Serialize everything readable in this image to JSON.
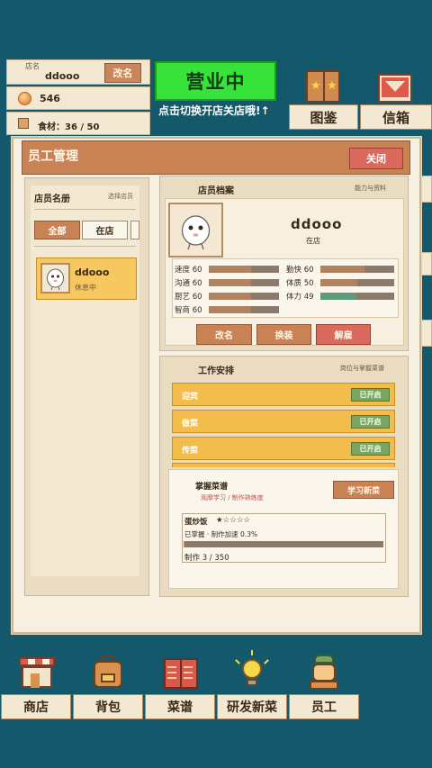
{
  "hud": {
    "name_label": "店名",
    "store_name": "ddooo",
    "rename_btn": "改名",
    "coins": "546",
    "food": "食材：36 / 50",
    "open_btn": "营业中",
    "open_hint": "点击切换开店关店哦!↑",
    "album_label": "图鉴",
    "mail_label": "信箱"
  },
  "modal": {
    "title": "员工管理",
    "close_btn": "关闭",
    "roster": {
      "title": "店员名册",
      "subtitle": "选择店员",
      "tabs": [
        "全部",
        "在店"
      ],
      "staff": [
        {
          "name": "ddooo",
          "status": "休息中"
        }
      ]
    },
    "profile": {
      "title": "店员档案",
      "subtitle": "能力与资料",
      "name": "ddooo",
      "state": "在店",
      "stats": [
        {
          "label": "速度",
          "value": 60,
          "max": 100
        },
        {
          "label": "勤快",
          "value": 60,
          "max": 100
        },
        {
          "label": "沟通",
          "value": 60,
          "max": 100
        },
        {
          "label": "体质",
          "value": 50,
          "max": 100
        },
        {
          "label": "厨艺",
          "value": 60,
          "max": 100
        },
        {
          "label": "体力",
          "value": 49,
          "max": 100
        },
        {
          "label": "智商",
          "value": 60,
          "max": 100
        }
      ],
      "actions": {
        "rename": "改名",
        "outfit": "换装",
        "fire": "解雇"
      }
    },
    "work": {
      "title": "工作安排",
      "subtitle": "岗位与掌握菜谱",
      "jobs": [
        {
          "label": "迎宾",
          "badge": "已开启"
        },
        {
          "label": "做菜",
          "badge": "已开启"
        },
        {
          "label": "传菜",
          "badge": "已开启"
        }
      ],
      "recipes": {
        "title": "掌握菜谱",
        "subtitle": "观摩学习 / 制作熟练度",
        "learn_btn": "学习新菜",
        "item": {
          "name": "蛋炒饭",
          "stars": "★☆☆☆☆",
          "state": "已掌握 · 制作加速 0.3%",
          "progress": "制作 3 / 350",
          "made": 3,
          "target": 350
        }
      }
    }
  },
  "nav": {
    "shop": "商店",
    "bag": "背包",
    "menu": "菜谱",
    "develop": "研发新菜",
    "staff": "员工"
  },
  "colors": {
    "background": "#14586b",
    "panel": "#f7efdf",
    "accent_brown": "#c98253",
    "open_green": "#37e23b",
    "job_yellow": "#f2bd4a",
    "badge_green": "#7aa462",
    "danger_red": "#d96a5d",
    "bar_brown": "#b08360",
    "bar_green": "#5e9a7e"
  }
}
